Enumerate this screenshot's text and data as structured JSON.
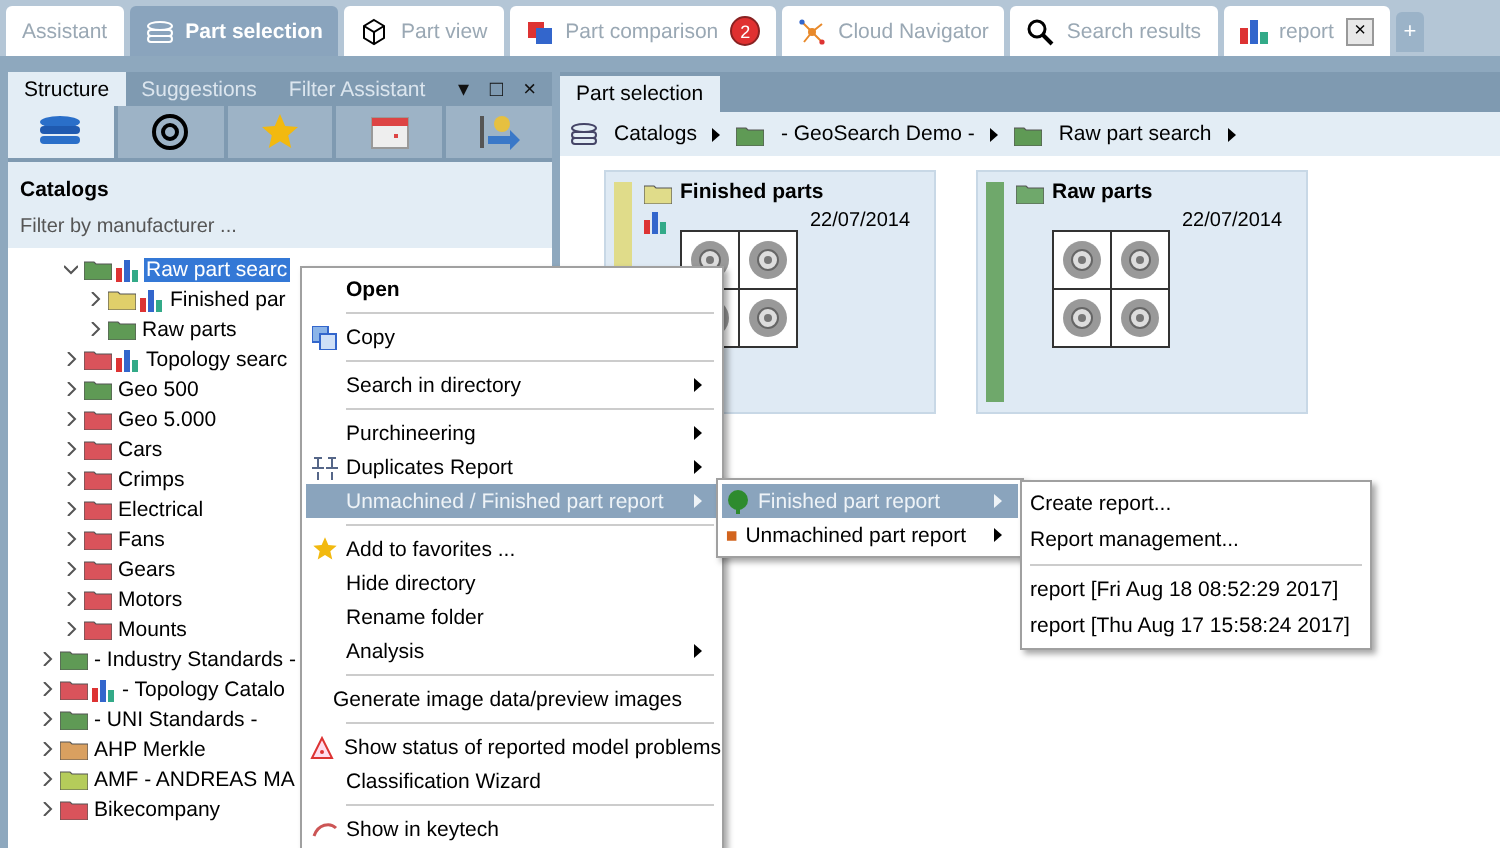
{
  "top_tabs": [
    {
      "label": "Assistant",
      "selected": false
    },
    {
      "label": "Part selection",
      "selected": true
    },
    {
      "label": "Part view",
      "selected": false
    },
    {
      "label": "Part comparison",
      "selected": false,
      "badge": "2"
    },
    {
      "label": "Cloud Navigator",
      "selected": false
    },
    {
      "label": "Search results",
      "selected": false
    },
    {
      "label": "report",
      "selected": false,
      "close": "×"
    }
  ],
  "new_tab_button": "+",
  "left_panel": {
    "tabs": [
      {
        "label": "Structure",
        "selected": true
      },
      {
        "label": "Suggestions",
        "selected": false
      },
      {
        "label": "Filter Assistant",
        "selected": false
      }
    ],
    "controls": [
      "▾",
      "□",
      "×"
    ],
    "views": [
      {
        "selected": true
      },
      {
        "selected": false
      },
      {
        "selected": false
      },
      {
        "selected": false
      },
      {
        "selected": false
      }
    ],
    "heading": "Catalogs",
    "filter": {
      "placeholder": "Filter by manufacturer ..."
    },
    "tree": {
      "continued_children": [
        {
          "label": "Raw part searc",
          "color": "#5f9a55",
          "chart": true,
          "expanded": true,
          "selected": true,
          "children": [
            {
              "label": "Finished par",
              "color": "#e0cf6a",
              "chart": true,
              "expanded": false,
              "selected": false
            },
            {
              "label": "Raw parts",
              "color": "#5f9a55",
              "chart": false,
              "expanded": false,
              "selected": false
            }
          ]
        },
        {
          "label": "Topology searc",
          "color": "#d9535b",
          "chart": true,
          "expanded": false,
          "selected": false
        },
        {
          "label": "Geo 500",
          "color": "#5f9a55",
          "chart": false,
          "expanded": false,
          "selected": false
        },
        {
          "label": "Geo 5.000",
          "color": "#d9535b",
          "chart": false,
          "expanded": false,
          "selected": false
        },
        {
          "label": "Cars",
          "color": "#d9535b",
          "chart": false,
          "expanded": false,
          "selected": false
        },
        {
          "label": "Crimps",
          "color": "#d9535b",
          "chart": false,
          "expanded": false,
          "selected": false
        },
        {
          "label": "Electrical",
          "color": "#d9535b",
          "chart": false,
          "expanded": false,
          "selected": false
        },
        {
          "label": "Fans",
          "color": "#d9535b",
          "chart": false,
          "expanded": false,
          "selected": false
        },
        {
          "label": "Gears",
          "color": "#d9535b",
          "chart": false,
          "expanded": false,
          "selected": false
        },
        {
          "label": "Motors",
          "color": "#d9535b",
          "chart": false,
          "expanded": false,
          "selected": false
        },
        {
          "label": "Mounts",
          "color": "#d9535b",
          "chart": false,
          "expanded": false,
          "selected": false
        }
      ],
      "items": [
        {
          "label": "- Industry Standards -",
          "color": "#5f9a55",
          "chart": false,
          "expanded": false,
          "selected": false
        },
        {
          "label": "- Topology Catalo",
          "color": "#d9535b",
          "chart": true,
          "expanded": false,
          "selected": false
        },
        {
          "label": "- UNI Standards -",
          "color": "#5f9a55",
          "chart": false,
          "expanded": false,
          "selected": false
        },
        {
          "label": "AHP Merkle",
          "color": "#d9a060",
          "chart": false,
          "expanded": false,
          "selected": false
        },
        {
          "label": "AMF - ANDREAS MA",
          "color": "#b5cc5a",
          "chart": false,
          "expanded": false,
          "selected": false
        },
        {
          "label": "Bikecompany",
          "color": "#d9535b",
          "chart": false,
          "expanded": false,
          "selected": false
        }
      ]
    }
  },
  "right_panel": {
    "tab": "Part selection",
    "breadcrumb": [
      {
        "label": "Catalogs"
      },
      {
        "label": "- GeoSearch Demo -"
      },
      {
        "label": "Raw part search"
      }
    ],
    "cards": [
      {
        "title": "Finished parts",
        "date": "22/07/2014",
        "color": "#e0dc8a",
        "chart": true
      },
      {
        "title": "Raw parts",
        "date": "22/07/2014",
        "color": "#6fa86b",
        "chart": false
      }
    ]
  },
  "context_menu": {
    "items": [
      {
        "kind": "item",
        "label": "Open",
        "default": true,
        "submenu": false,
        "selected": false
      },
      {
        "kind": "separator"
      },
      {
        "kind": "item",
        "label": "Copy",
        "default": false,
        "submenu": false,
        "selected": false
      },
      {
        "kind": "separator"
      },
      {
        "kind": "item",
        "label": "Search in directory",
        "default": false,
        "submenu": true,
        "selected": false
      },
      {
        "kind": "separator"
      },
      {
        "kind": "item",
        "label": "Purchineering",
        "default": false,
        "submenu": true,
        "selected": false
      },
      {
        "kind": "item",
        "label": "Duplicates Report",
        "default": false,
        "submenu": true,
        "selected": false
      },
      {
        "kind": "item",
        "label": "Unmachined / Finished part report",
        "default": false,
        "submenu": true,
        "selected": true
      },
      {
        "kind": "separator"
      },
      {
        "kind": "item",
        "label": "Add to favorites ...",
        "default": false,
        "submenu": false,
        "selected": false
      },
      {
        "kind": "item",
        "label": "Hide directory",
        "default": false,
        "submenu": false,
        "selected": false
      },
      {
        "kind": "item",
        "label": "Rename folder",
        "default": false,
        "submenu": false,
        "selected": false
      },
      {
        "kind": "item",
        "label": "Analysis",
        "default": false,
        "submenu": true,
        "selected": false
      },
      {
        "kind": "separator"
      },
      {
        "kind": "item",
        "label": "Generate image data/preview images",
        "default": false,
        "submenu": false,
        "selected": false
      },
      {
        "kind": "separator"
      },
      {
        "kind": "item",
        "label": "Show status of reported model problems",
        "default": false,
        "submenu": false,
        "selected": false
      },
      {
        "kind": "item",
        "label": "Classification Wizard",
        "default": false,
        "submenu": false,
        "selected": false
      },
      {
        "kind": "separator"
      },
      {
        "kind": "item",
        "label": "Show in keytech",
        "default": false,
        "submenu": false,
        "selected": false
      }
    ]
  },
  "submenu": {
    "items": [
      {
        "label": "Finished part report",
        "submenu": true,
        "selected": true,
        "color": "#2e8b2e"
      },
      {
        "label": "Unmachined part report",
        "submenu": true,
        "selected": false,
        "color": "#d2641e"
      }
    ]
  },
  "report_menu": {
    "items": [
      {
        "kind": "item",
        "label": "Create report..."
      },
      {
        "kind": "item",
        "label": "Report management..."
      },
      {
        "kind": "separator"
      },
      {
        "kind": "item",
        "label": "report [Fri Aug 18 08:52:29 2017]"
      },
      {
        "kind": "item",
        "label": "report [Thu Aug 17 15:58:24 2017]"
      }
    ]
  }
}
